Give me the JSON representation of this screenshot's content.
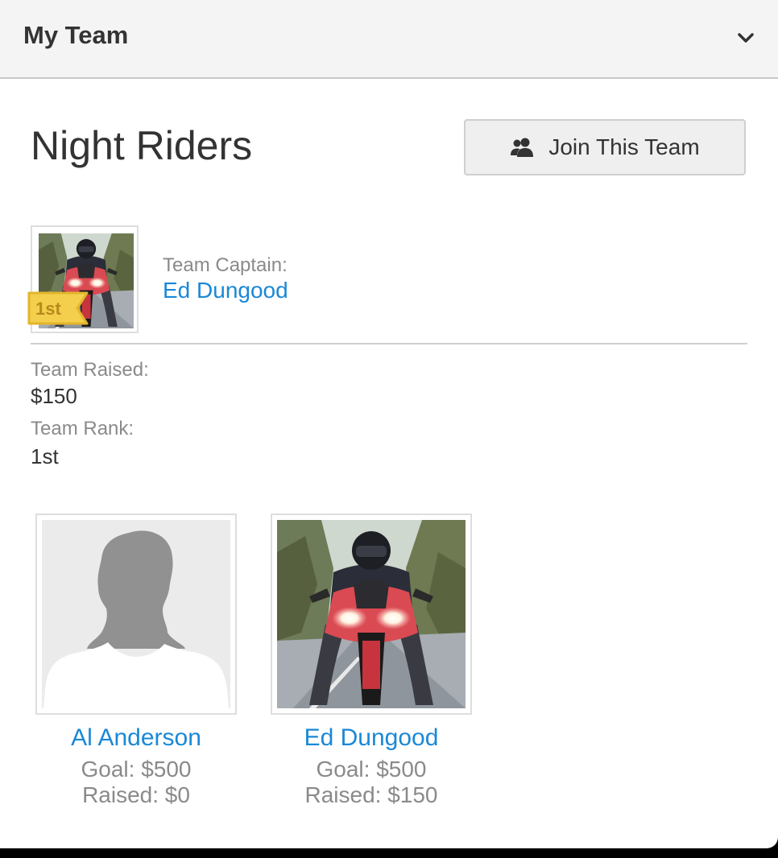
{
  "header": {
    "title": "My Team"
  },
  "team": {
    "name": "Night Riders",
    "join_label": "Join This Team",
    "captain_label": "Team Captain:",
    "captain_name": "Ed Dungood",
    "captain_rank_badge": "1st",
    "raised_label": "Team Raised:",
    "raised_value": "$150",
    "rank_label": "Team Rank:",
    "rank_value": "1st"
  },
  "members": [
    {
      "name": "Al Anderson",
      "goal": "Goal: $500",
      "raised": "Raised: $0",
      "photo": "default-avatar-silhouette"
    },
    {
      "name": "Ed Dungood",
      "goal": "Goal: $500",
      "raised": "Raised: $150",
      "photo": "motorcycle-rider-photo"
    }
  ],
  "colors": {
    "link": "#1a88d6",
    "badge": "#f3cf4d",
    "header_bg": "#f4f4f4"
  }
}
